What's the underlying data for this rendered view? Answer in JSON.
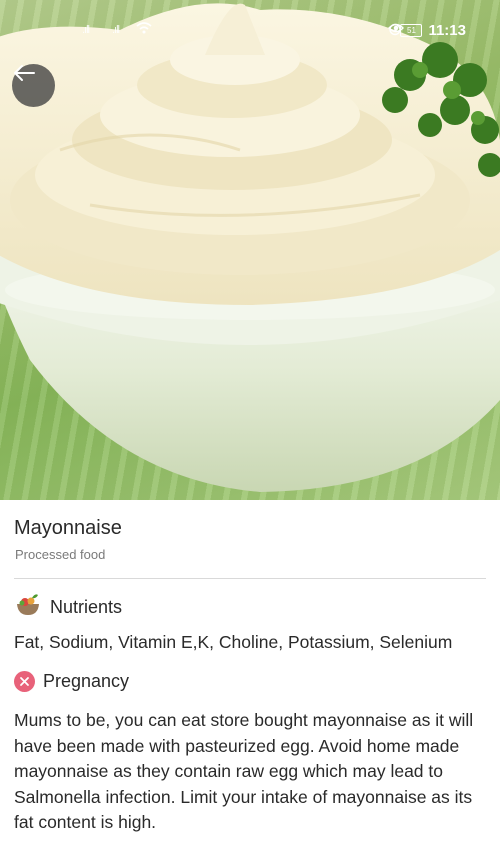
{
  "status_bar": {
    "time": "11:13",
    "battery": "51",
    "signal_1": ".ıll",
    "signal_2": ".ıll"
  },
  "back_button": {
    "icon": "arrow-left-icon"
  },
  "food": {
    "name": "Mayonnaise",
    "category": "Processed food"
  },
  "nutrients": {
    "heading": "Nutrients",
    "icon": "bowl-icon",
    "text": "Fat, Sodium, Vitamin E,K, Choline, Potassium, Selenium"
  },
  "pregnancy": {
    "heading": "Pregnancy",
    "icon": "close-circle-icon",
    "icon_color": "#e8627a",
    "text": "Mums to be, you can eat store bought mayonnaise as it will have been made with pasteurized egg. Avoid home made mayonnaise as they contain raw egg which may lead to Salmonella infection. Limit your intake of mayonnaise as its fat content is high."
  }
}
